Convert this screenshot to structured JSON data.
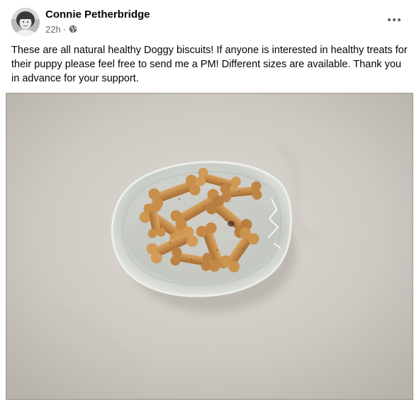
{
  "post": {
    "author_name": "Connie Petherbridge",
    "timestamp": "22h",
    "separator": "·",
    "privacy_icon": "globe-icon",
    "more_icon": "more-options-icon",
    "caption": "These are all natural healthy Doggy biscuits! If anyone is interested in healthy treats for their puppy please feel free to send me a PM! Different sizes are available. Thank you in advance for your support."
  },
  "colors": {
    "text_primary": "#050505",
    "text_secondary": "#65676b",
    "carpet": "#d3cfc9",
    "biscuit": "#c8914f"
  }
}
